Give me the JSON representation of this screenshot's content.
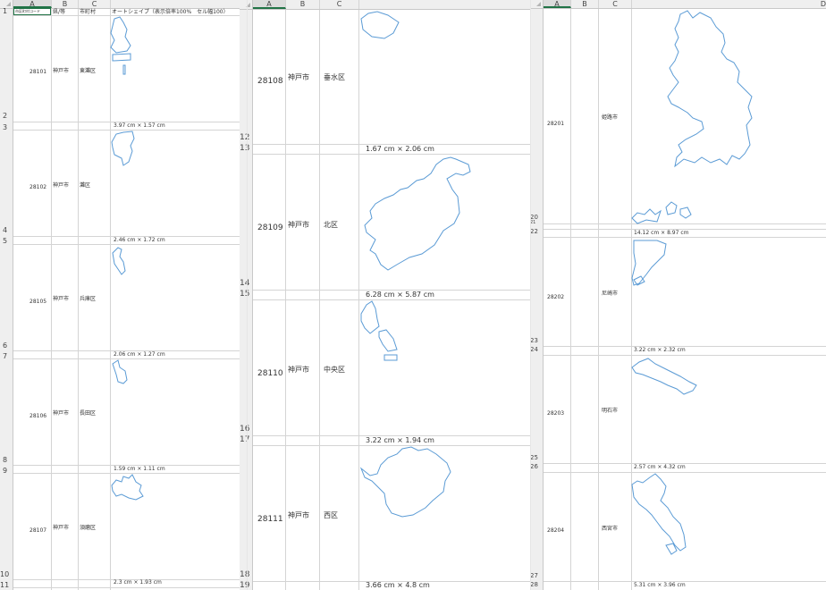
{
  "left": {
    "columns": [
      "A",
      "B",
      "C"
    ],
    "header": {
      "code": "市区町村コード",
      "pref": "県/等",
      "city": "市町村",
      "shape": "オートシェイプ（表示倍率100%　セル幅100）"
    },
    "row_numbers": [
      "1",
      "2",
      "3",
      "4",
      "5",
      "6",
      "7",
      "8",
      "9",
      "10",
      "11"
    ],
    "records": [
      {
        "code": "28101",
        "pref": "神戸市",
        "city": "東灘区",
        "size": "3.97 cm × 1.57 cm"
      },
      {
        "code": "28102",
        "pref": "神戸市",
        "city": "灘区",
        "size": "2.46 cm × 1.72 cm"
      },
      {
        "code": "28105",
        "pref": "神戸市",
        "city": "兵庫区",
        "size": "2.06 cm × 1.27 cm"
      },
      {
        "code": "28106",
        "pref": "神戸市",
        "city": "長田区",
        "size": "1.59 cm × 1.11 cm"
      },
      {
        "code": "28107",
        "pref": "神戸市",
        "city": "須磨区",
        "size": "2.3 cm × 1.93 cm"
      }
    ]
  },
  "middle": {
    "columns": [
      "A",
      "B",
      "C"
    ],
    "row_numbers": [
      "12",
      "13",
      "14",
      "15",
      "16",
      "17",
      "18",
      "19"
    ],
    "records": [
      {
        "code": "28108",
        "pref": "神戸市",
        "city": "垂水区",
        "size": "1.67 cm × 2.06 cm"
      },
      {
        "code": "28109",
        "pref": "神戸市",
        "city": "北区",
        "size": "6.28 cm × 5.87 cm"
      },
      {
        "code": "28110",
        "pref": "神戸市",
        "city": "中央区",
        "size": "3.22 cm × 1.94 cm"
      },
      {
        "code": "28111",
        "pref": "神戸市",
        "city": "西区",
        "size": "3.66 cm × 4.8 cm"
      }
    ]
  },
  "right": {
    "columns": [
      "A",
      "B",
      "C",
      "D"
    ],
    "row_numbers": [
      "20",
      "21",
      "22",
      "23",
      "24",
      "25",
      "26",
      "27",
      "28"
    ],
    "records": [
      {
        "code": "28201",
        "city": "姫路市",
        "size": "14.12 cm × 8.97 cm"
      },
      {
        "code": "28202",
        "city": "尼崎市",
        "size": "3.22 cm × 2.32 cm"
      },
      {
        "code": "28203",
        "city": "明石市",
        "size": "2.57 cm × 4.32 cm"
      },
      {
        "code": "28204",
        "city": "西宮市",
        "size": "5.31 cm × 3.96 cm"
      }
    ]
  }
}
